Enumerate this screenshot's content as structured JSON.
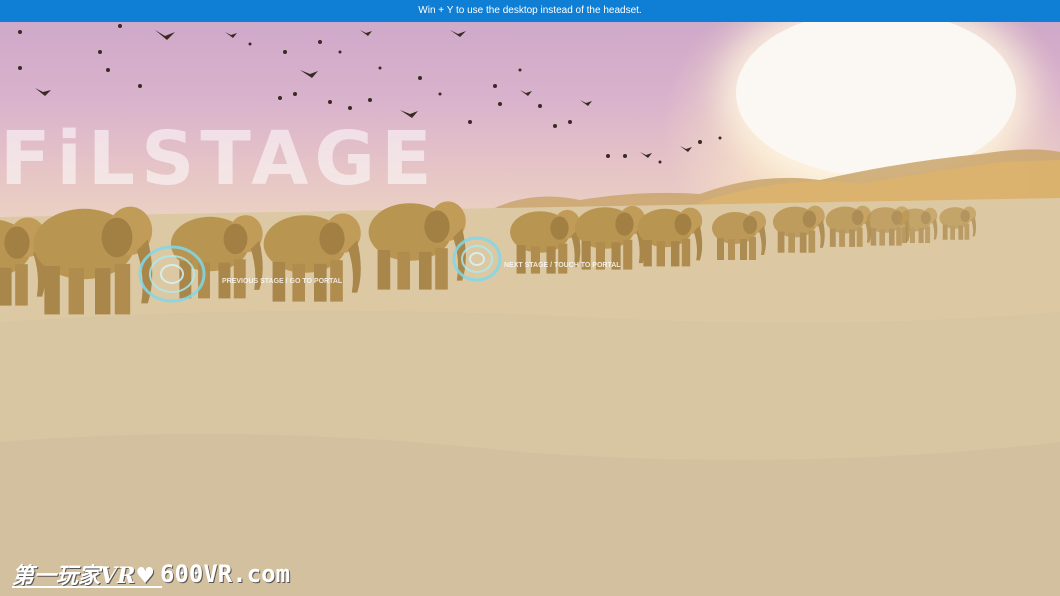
{
  "banner": {
    "text": "Win + Y to use the desktop instead of the headset."
  },
  "scene": {
    "title": "FiLSTAGE",
    "portals": [
      {
        "label": "PREVIOUS STAGE / GO TO PORTAL"
      },
      {
        "label": "NEXT STAGE / TOUCH TO PORTAL"
      }
    ]
  },
  "watermark": {
    "cn": "第一玩家VR♥",
    "site": "600VR.com"
  },
  "colors": {
    "banner": "#0f7fd6",
    "sky": "#d9b2cc",
    "sand": "#d9c5a2",
    "elephant": "#b99552",
    "portal": "#7fd8ea"
  }
}
